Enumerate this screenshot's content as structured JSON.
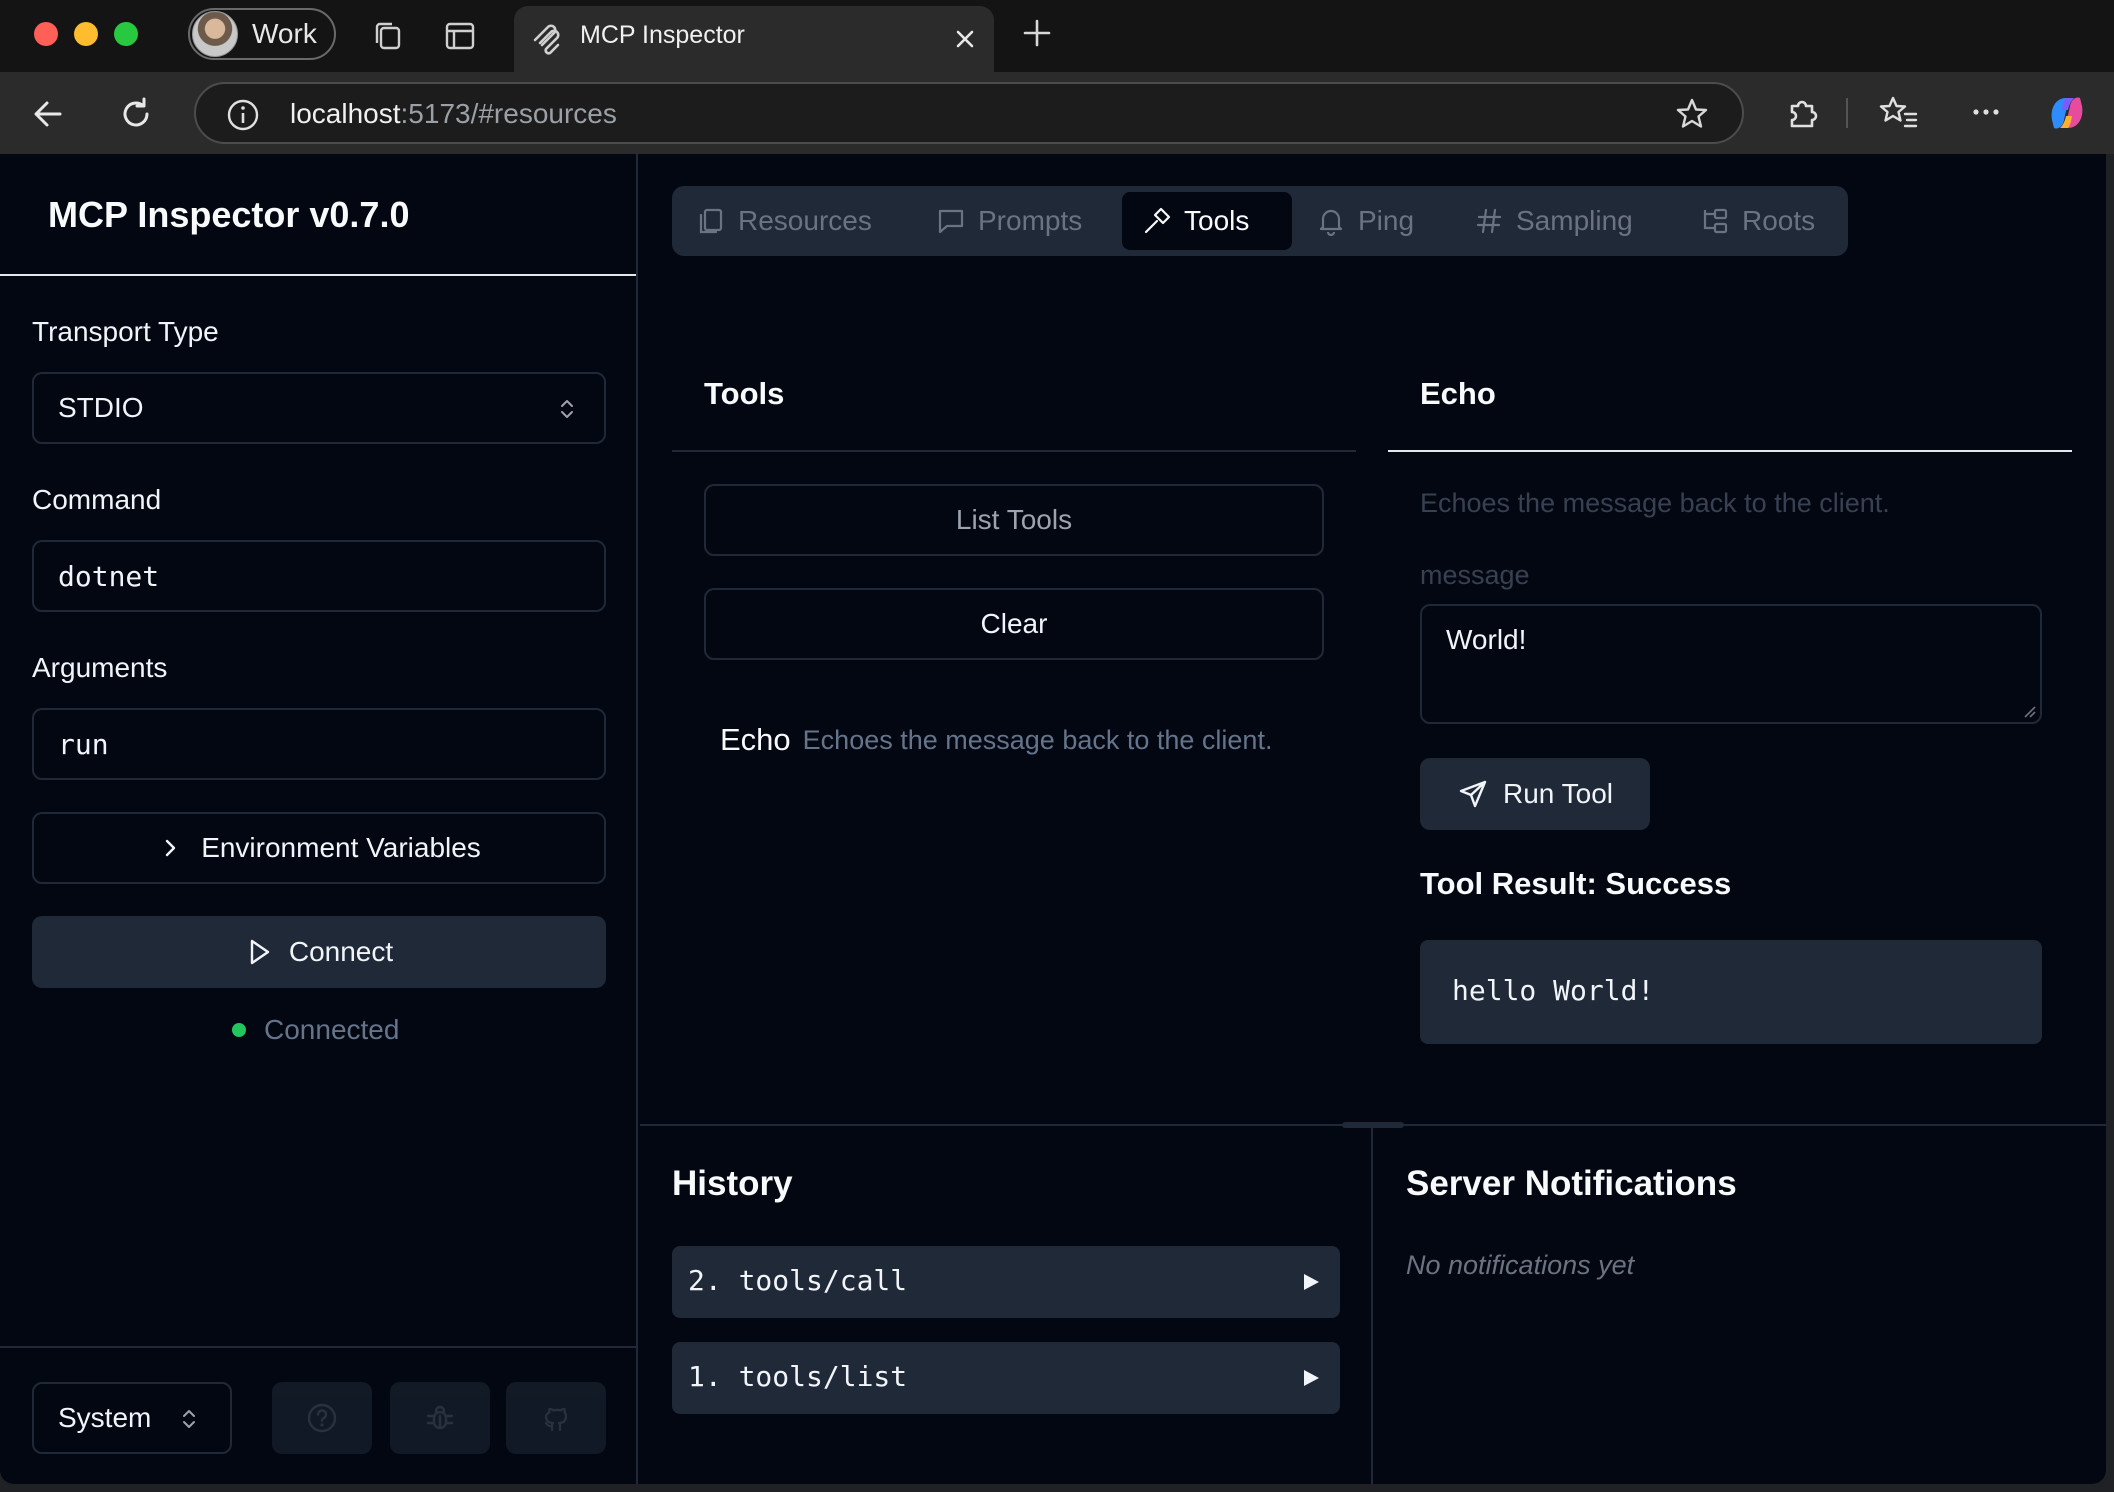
{
  "browser": {
    "profile_label": "Work",
    "tab_title": "MCP Inspector",
    "url_host": "localhost",
    "url_rest": ":5173/#resources"
  },
  "sidebar": {
    "title": "MCP Inspector v0.7.0",
    "transport_label": "Transport Type",
    "transport_value": "STDIO",
    "command_label": "Command",
    "command_value": "dotnet",
    "arguments_label": "Arguments",
    "arguments_value": "run",
    "env_label": "Environment Variables",
    "connect_label": "Connect",
    "status_text": "Connected",
    "status_color": "#22c55e",
    "theme_value": "System"
  },
  "tabs": [
    {
      "label": "Resources",
      "icon": "file-copy-icon"
    },
    {
      "label": "Prompts",
      "icon": "message-square-icon"
    },
    {
      "label": "Tools",
      "icon": "hammer-icon"
    },
    {
      "label": "Ping",
      "icon": "bell-icon"
    },
    {
      "label": "Sampling",
      "icon": "hash-icon"
    },
    {
      "label": "Roots",
      "icon": "folder-tree-icon"
    }
  ],
  "tools_panel": {
    "title": "Tools",
    "list_button": "List Tools",
    "clear_button": "Clear",
    "tool_name": "Echo",
    "tool_desc": "Echoes the message back to the client."
  },
  "echo_panel": {
    "title": "Echo",
    "description": "Echoes the message back to the client.",
    "message_label": "message",
    "message_value": "World!",
    "run_button": "Run Tool",
    "result_title": "Tool Result: Success",
    "result_text": "hello World!"
  },
  "history": {
    "title": "History",
    "items": [
      {
        "label": "2. tools/call"
      },
      {
        "label": "1. tools/list"
      }
    ]
  },
  "notifications": {
    "title": "Server Notifications",
    "empty_text": "No notifications yet"
  }
}
